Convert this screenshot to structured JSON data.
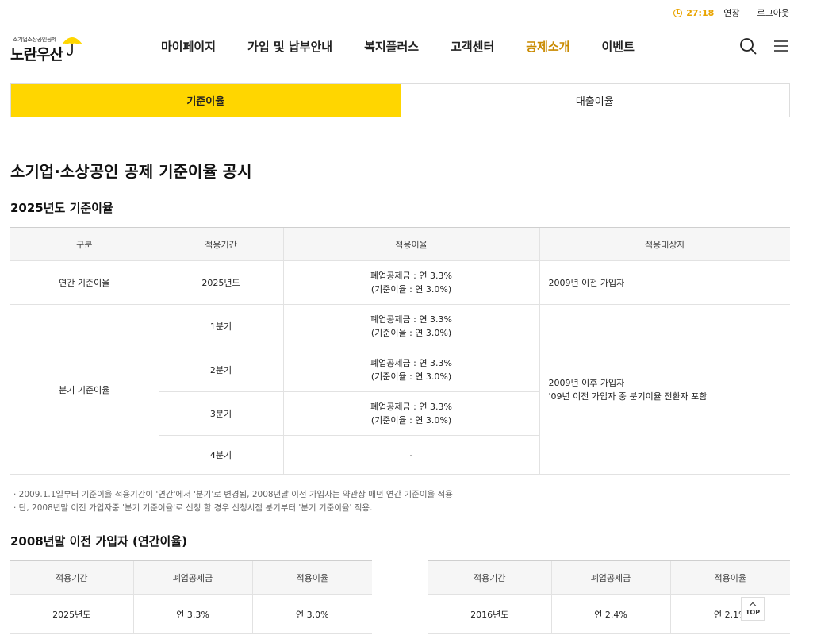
{
  "util": {
    "timer": "27:18",
    "extend_label": "연장",
    "logout_label": "로그아웃"
  },
  "logo": {
    "tagline": "소기업소상공인공제",
    "brand": "노란우산",
    "accent_color": "#ffd600"
  },
  "gnb": {
    "items": [
      {
        "label": "마이페이지"
      },
      {
        "label": "가입 및 납부안내"
      },
      {
        "label": "복지플러스"
      },
      {
        "label": "고객센터"
      },
      {
        "label": "공제소개",
        "active": true
      },
      {
        "label": "이벤트"
      }
    ],
    "active_color": "#c98a00"
  },
  "icons": {
    "search": "search-icon",
    "menu": "hamburger-menu-icon",
    "clock": "clock-icon"
  },
  "tabs": [
    {
      "label": "기준이율",
      "active": true
    },
    {
      "label": "대출이율",
      "active": false
    }
  ],
  "page_title": "소기업·소상공인 공제 기준이율 공시",
  "section_2025": {
    "title": "2025년도 기준이율",
    "headers": [
      "구분",
      "적용기간",
      "적용이율",
      "적용대상자"
    ],
    "annual": {
      "category": "연간 기준이율",
      "period": "2025년도",
      "rate_line1": "폐업공제금 : 연 3.3%",
      "rate_line2": "(기준이율 : 연 3.0%)",
      "target": "2009년 이전 가입자"
    },
    "quarterly": {
      "category": "분기 기준이율",
      "target_line1": "2009년 이후 가입자",
      "target_line2": "'09년 이전 가입자 중 분기이율 전환자 포함",
      "rows": [
        {
          "period": "1분기",
          "rate_line1": "폐업공제금 : 연 3.3%",
          "rate_line2": "(기준이율 : 연 3.0%)"
        },
        {
          "period": "2분기",
          "rate_line1": "폐업공제금 : 연 3.3%",
          "rate_line2": "(기준이율 : 연 3.0%)"
        },
        {
          "period": "3분기",
          "rate_line1": "폐업공제금 : 연 3.3%",
          "rate_line2": "(기준이율 : 연 3.0%)"
        },
        {
          "period": "4분기",
          "rate": "-"
        }
      ]
    }
  },
  "notes": [
    "· 2009.1.1일부터 기준이율 적용기간이 '연간'에서 '분기'로 변경됨, 2008년말 이전 가입자는 약관상 매년 연간 기준이율 적용",
    "· 단, 2008년말 이전 가입자중 '분기 기준이율'로 신청 할 경우 신청시점 분기부터 '분기 기준이율' 적용."
  ],
  "section_2008": {
    "title": "2008년말 이전 가입자 (연간이율)",
    "headers": [
      "적용기간",
      "폐업공제금",
      "적용이율"
    ],
    "left_rows": [
      {
        "period": "2025년도",
        "closure": "연 3.3%",
        "rate": "연 3.0%"
      }
    ],
    "right_rows": [
      {
        "period": "2016년도",
        "closure": "연 2.4%",
        "rate": "연 2.1%"
      }
    ]
  },
  "top_button": {
    "label": "TOP"
  }
}
